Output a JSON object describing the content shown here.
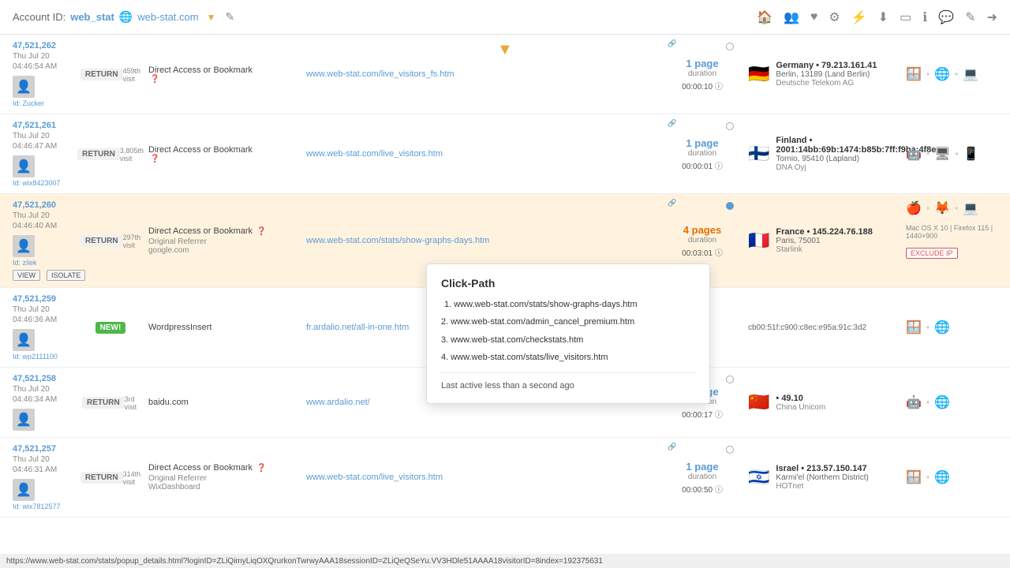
{
  "header": {
    "account_id_label": "Account ID:",
    "account_name": "web_stat",
    "domain": "web-stat.com",
    "dropdown_arrow": "▼",
    "icons": [
      "🏠",
      "👥",
      "♥",
      "⚙",
      "⚡",
      "⬇",
      "▭",
      "ℹ",
      "💬",
      "✎",
      "➜"
    ]
  },
  "status_bar": {
    "url": "https://www.web-stat.com/stats/popup_details.html?loginID=ZLiQimyLiqOXQrurkonTwrwyAAA18sessionID=ZLiQeQSeYu.VV3HDle51AAAA18visitorID=8index=192375631"
  },
  "visitors": [
    {
      "id": "47,521,262",
      "date": "Thu Jul 20",
      "time": "04:46:54 AM",
      "type": "RETURN",
      "visit_num": "459th visit",
      "referrer": "Direct Access or Bookmark",
      "referrer_help": true,
      "landing": "www.web-stat.com/live_visitors_fs.htm",
      "pages": "1 page",
      "duration": "00:00:10",
      "flag": "🇩🇪",
      "country": "Germany • 79.213.161.41",
      "city": "Berlin, 13189 (Land Berlin)",
      "isp": "Deutsche Telekom AG",
      "devices": [
        "🪟",
        "·",
        "🌐",
        "·",
        "💻"
      ],
      "visitor_label": "Id: Zucker",
      "has_circle": false,
      "circle_active": false,
      "has_ext_link": true
    },
    {
      "id": "47,521,261",
      "date": "Thu Jul 20",
      "time": "04:46:47 AM",
      "type": "RETURN",
      "visit_num": "3,805th visit",
      "referrer": "Direct Access or Bookmark",
      "referrer_help": true,
      "landing": "www.web-stat.com/live_visitors.htm",
      "pages": "1 page",
      "duration": "00:00:01",
      "flag": "🇫🇮",
      "country": "Finland • 2001:14bb:69b:1474:b85b:7ff:f9ba:4f8e",
      "city": "Tornio, 95410 (Lapland)",
      "isp": "DNA Oyj",
      "devices": [
        "🤖",
        "·",
        "🖥",
        "·",
        "📱"
      ],
      "visitor_label": "Id: wix8423007",
      "has_circle": false,
      "circle_active": false,
      "has_ext_link": true
    },
    {
      "id": "47,521,260",
      "date": "Thu Jul 20",
      "time": "04:46:40 AM",
      "type": "RETURN",
      "visit_num": "297th visit",
      "referrer": "Direct Access or Bookmark",
      "referrer_help": true,
      "referrer_sub": "Original Referrer",
      "referrer_link": "google.com",
      "landing": "www.web-stat.com/stats/show-graphs-days.htm",
      "pages": "4 pages",
      "duration": "00:03:01",
      "flag": "🇫🇷",
      "country": "France • 145.224.76.188",
      "city": "Paris, 75001",
      "isp": "Starlink",
      "devices": [
        "🍎",
        "·",
        "🦊",
        "·",
        "💻"
      ],
      "visitor_label": "Id: zilek",
      "has_circle": true,
      "circle_active": true,
      "has_ext_link": true,
      "os_info": "Mac OS X 10  |  Firefox 115  |  1440×900",
      "show_actions": true,
      "pages_bold": true
    },
    {
      "id": "47,521,259",
      "date": "Thu Jul 20",
      "time": "04:46:36 AM",
      "type": "NEW!",
      "visit_num": "",
      "referrer": "WordpressInsert",
      "referrer_help": false,
      "landing": "fr.ardalio.net/all-in-one.htm",
      "pages": "",
      "duration": "",
      "flag": "",
      "country": "",
      "city": "cb00:51f:c900:c8ec:e95a:91c:3d2",
      "isp": "",
      "devices": [
        "🪟",
        "·",
        "🌐e",
        "·",
        ""
      ],
      "visitor_label": "Id: wp2111100",
      "has_circle": false,
      "circle_active": false,
      "has_ext_link": true
    },
    {
      "id": "47,521,258",
      "date": "Thu Jul 20",
      "time": "04:46:34 AM",
      "type": "RETURN",
      "visit_num": "3rd visit",
      "referrer": "baidu.com",
      "referrer_help": false,
      "landing": "www.ardalio.net/",
      "pages": "1 page",
      "duration": "00:00:17",
      "flag": "🇨🇳",
      "country": "• 49.10",
      "city": "",
      "isp": "China Unicom",
      "devices": [
        "🤖",
        "·",
        "🌐",
        "·",
        ""
      ],
      "visitor_label": "",
      "has_circle": false,
      "circle_active": false,
      "has_ext_link": true
    },
    {
      "id": "47,521,257",
      "date": "Thu Jul 20",
      "time": "04:46:31 AM",
      "type": "RETURN",
      "visit_num": "314th visit",
      "referrer": "Direct Access or Bookmark",
      "referrer_help": true,
      "referrer_sub": "Original Referrer",
      "referrer_link": "WixDashboard",
      "landing": "www.web-stat.com/live_visitors.htm",
      "pages": "1 page",
      "duration": "00:00:50",
      "flag": "🇮🇱",
      "country": "Israel • 213.57.150.147",
      "city": "Karmi'el (Northern District)",
      "isp": "HOTnet",
      "devices": [
        "🪟",
        "·",
        "🌐e",
        "·",
        ""
      ],
      "visitor_label": "Id: wix7812577",
      "has_circle": false,
      "circle_active": false,
      "has_ext_link": true
    }
  ],
  "popup": {
    "title": "Click-Path",
    "items": [
      "1. www.web-stat.com/stats/show-graphs-days.htm",
      "2. www.web-stat.com/admin_cancel_premium.htm",
      "3. www.web-stat.com/checkstats.htm",
      "4. www.web-stat.com/stats/live_visitors.htm"
    ],
    "last_active": "Last active less than a second ago"
  }
}
